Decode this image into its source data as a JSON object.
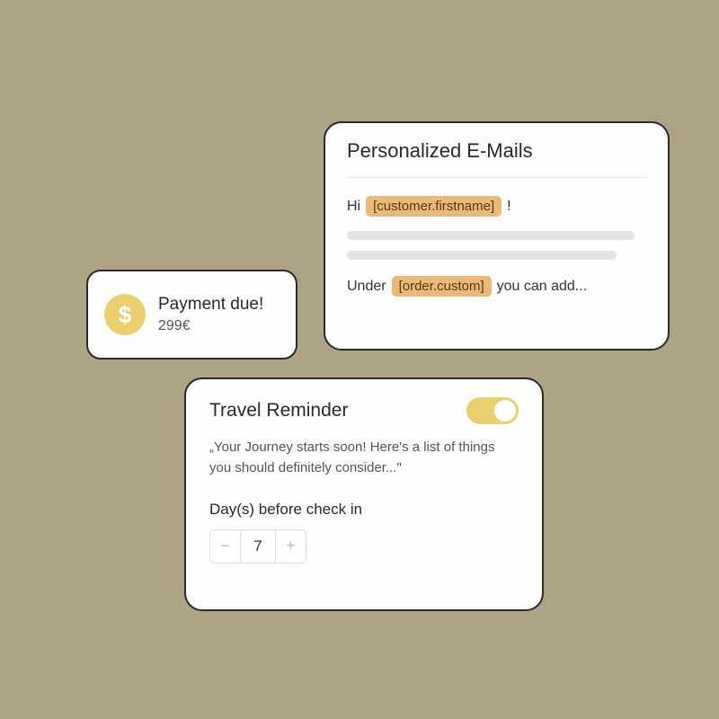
{
  "payment": {
    "title": "Payment due!",
    "amount": "299€"
  },
  "emails": {
    "heading": "Personalized E-Mails",
    "greeting_prefix": "Hi",
    "greeting_tag": "[customer.firstname]",
    "greeting_suffix": "!",
    "line2_prefix": "Under",
    "line2_tag": "[order.custom]",
    "line2_suffix": "you can add..."
  },
  "travel": {
    "heading": "Travel Reminder",
    "message": "„Your Journey starts soon! Here's a list of things you should definitely consider...\"",
    "days_label": "Day(s) before check in",
    "days_value": "7",
    "minus": "−",
    "plus": "+"
  }
}
